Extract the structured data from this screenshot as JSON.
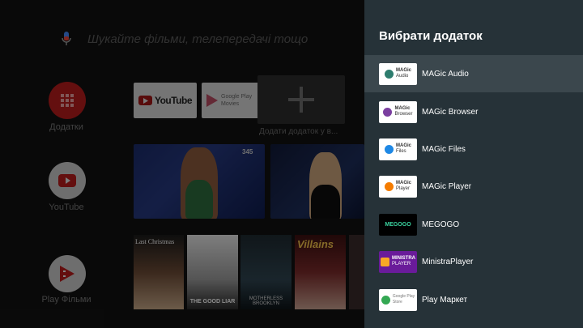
{
  "search": {
    "placeholder": "Шукайте фільми, телепередачі тощо"
  },
  "rows": [
    {
      "label": "Додатки",
      "icon": "apps-grid-icon",
      "color": "#c62828"
    },
    {
      "label": "YouTube",
      "icon": "youtube-play-icon",
      "color": "#c62828"
    },
    {
      "label": "Play Фільми",
      "icon": "play-movies-icon",
      "color": "#c62828"
    }
  ],
  "favorites": {
    "youtube": "YouTube",
    "google_play_line1": "Google Play",
    "google_play_line2": "Movies",
    "add_label": "Додати додаток у в..."
  },
  "video1_tag": "345",
  "posters": [
    {
      "title": "Last Christmas"
    },
    {
      "title": "THE GOOD LIAR"
    },
    {
      "title": "MOTHERLESS BROOKLYN"
    },
    {
      "title": "Villains"
    }
  ],
  "panel": {
    "title": "Вибрати додаток",
    "apps": [
      {
        "name": "MAGic Audio",
        "icon": "magic-audio-icon",
        "icon_line1": "MAGic",
        "icon_line2": "Audio",
        "accent": "#2e7d6e",
        "bg": "#ffffff",
        "selected": true
      },
      {
        "name": "MAGic Browser",
        "icon": "magic-browser-icon",
        "icon_line1": "MAGic",
        "icon_line2": "Browser",
        "accent": "#7b3fa0",
        "bg": "#ffffff"
      },
      {
        "name": "MAGic Files",
        "icon": "magic-files-icon",
        "icon_line1": "MAGic",
        "icon_line2": "Files",
        "accent": "#1e88e5",
        "bg": "#ffffff"
      },
      {
        "name": "MAGic Player",
        "icon": "magic-player-icon",
        "icon_line1": "MAGic",
        "icon_line2": "Player",
        "accent": "#f57c00",
        "bg": "#ffffff"
      },
      {
        "name": "MEGOGO",
        "icon": "megogo-icon",
        "icon_line1": "MEGOGO",
        "icon_line2": "",
        "accent": "#3ad29f",
        "bg": "#000000"
      },
      {
        "name": "MinistraPlayer",
        "icon": "ministra-player-icon",
        "icon_line1": "MINISTRA",
        "icon_line2": "PLAYER",
        "accent": "#f9a825",
        "bg": "#6a1b9a"
      },
      {
        "name": "Play Маркет",
        "icon": "play-store-icon",
        "icon_line1": "Google Play",
        "icon_line2": "Store",
        "accent": "#34a853",
        "bg": "#ffffff"
      }
    ]
  }
}
